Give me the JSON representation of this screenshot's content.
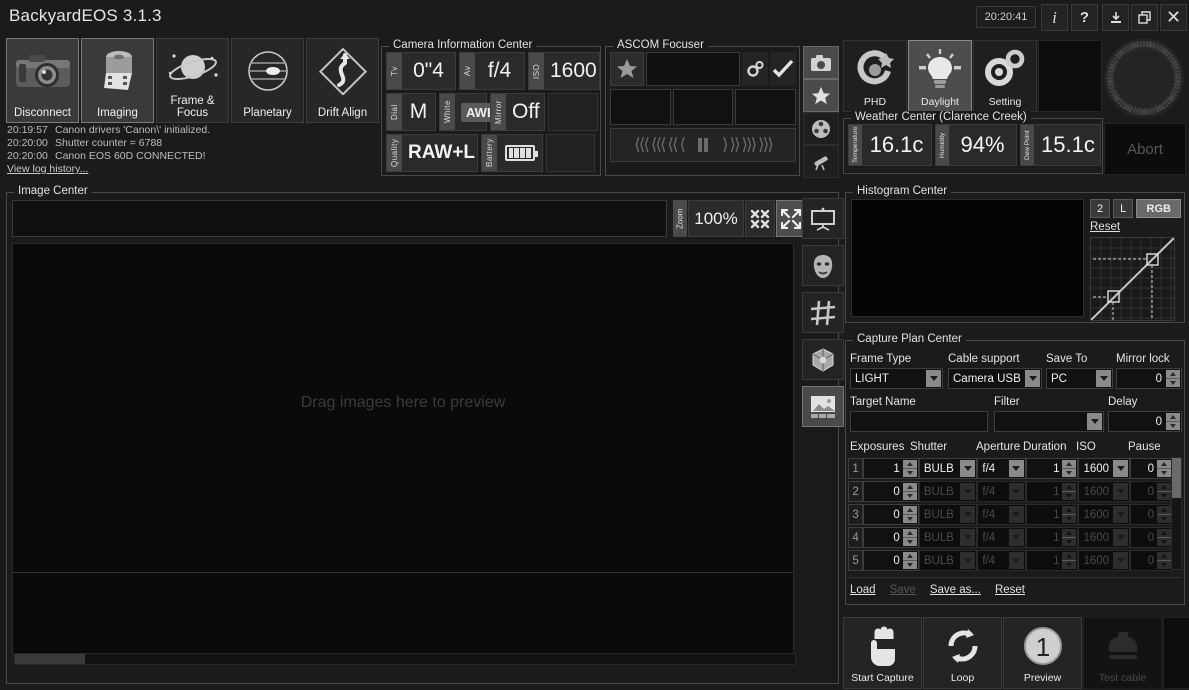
{
  "titlebar": {
    "app_title": "BackyardEOS 3.1.3",
    "clock": "20:20:41",
    "info_label": "i",
    "help_label": "?",
    "download_icon": "download-icon",
    "restore_icon": "restore-window-icon",
    "close_label": "✕"
  },
  "modebar": {
    "buttons": [
      {
        "label": "Disconnect",
        "icon": "dslr-camera-icon",
        "selected": true
      },
      {
        "label": "Imaging",
        "icon": "film-roll-icon",
        "selected": true
      },
      {
        "label": "Frame & Focus",
        "icon": "ringed-planet-icon",
        "selected": false
      },
      {
        "label": "Planetary",
        "icon": "jupiter-planet-icon",
        "selected": false
      },
      {
        "label": "Drift Align",
        "icon": "drift-align-diamond-icon",
        "selected": false
      }
    ]
  },
  "log": {
    "lines": [
      {
        "time": "20:19:57",
        "text": "Canon drivers 'Canon\\' initialized."
      },
      {
        "time": "20:20:00",
        "text": "Shutter counter = 6788"
      },
      {
        "time": "20:20:00",
        "text": "Canon EOS 60D CONNECTED!"
      }
    ],
    "history_link": "View log history..."
  },
  "camera_info": {
    "title": "Camera Information Center",
    "tv_tag": "Tv",
    "tv_value": "0\"4",
    "av_tag": "Av",
    "av_value": "f/4",
    "iso_tag": "ISO",
    "iso_value": "1600",
    "dial_tag": "Dial",
    "dial_value": "M",
    "white_tag": "White",
    "white_value": "AWB",
    "mirror_tag": "Mirror",
    "mirror_value": "Off",
    "quality_tag": "Quality",
    "quality_value": "RAW+L",
    "battery_tag": "Battery",
    "battery_level": 4
  },
  "ascom": {
    "title": "ASCOM Focuser",
    "star_icon": "star-icon",
    "position_value": "",
    "gear_icon": "gears-icon",
    "check_icon": "checkmark-icon",
    "in_arrows": "⟨⟨⟨ ⟨⟨⟨ ⟨⟨ ⟨",
    "pause_icon": "pause-icon",
    "out_arrows": "⟩ ⟩⟩ ⟩⟩⟩ ⟩⟩⟩"
  },
  "icon_strip": [
    {
      "icon": "camera-icon",
      "selected": true
    },
    {
      "icon": "star-icon",
      "selected": true
    },
    {
      "icon": "filter-wheel-icon",
      "selected": false
    },
    {
      "icon": "telescope-icon",
      "selected": false
    }
  ],
  "pds": {
    "buttons": [
      {
        "label": "PHD",
        "icon": "phd-guiding-icon",
        "selected": false
      },
      {
        "label": "Daylight",
        "icon": "lightbulb-icon",
        "selected": true
      },
      {
        "label": "Setting",
        "icon": "gears-icon",
        "selected": false
      }
    ]
  },
  "weather": {
    "title": "Weather Center (Clarence Creek)",
    "temperature_tag": "Temperature",
    "temperature_value": "16.1c",
    "humidity_tag": "Humidity",
    "humidity_value": "94%",
    "dewpoint_tag": "Dew Point",
    "dewpoint_value": "15.1c"
  },
  "abort": {
    "label": "Abort"
  },
  "image_center": {
    "title": "Image Center",
    "filename_value": "",
    "zoom_tag": "Zoom",
    "zoom_value": "100%",
    "zoom_out_icon": "zoom-shrink-icon",
    "zoom_fit_icon": "zoom-expand-icon",
    "projector_icon": "projector-screen-icon",
    "drag_hint": "Drag images here to preview",
    "sidebar": [
      {
        "icon": "mask-icon",
        "selected": false
      },
      {
        "icon": "grid-hash-icon",
        "selected": false
      },
      {
        "icon": "cube-3d-icon",
        "selected": false
      },
      {
        "icon": "image-thumbnails-icon",
        "selected": true
      }
    ]
  },
  "histogram": {
    "title": "Histogram Center",
    "btn_2": "2",
    "btn_l": "L",
    "btn_rgb": "RGB",
    "reset_link": "Reset"
  },
  "capture": {
    "title": "Capture Plan Center",
    "frame_type_label": "Frame Type",
    "frame_type_value": "LIGHT",
    "cable_support_label": "Cable support",
    "cable_support_value": "Camera USB",
    "save_to_label": "Save To",
    "save_to_value": "PC",
    "mirror_lock_label": "Mirror lock",
    "mirror_lock_value": "0",
    "target_name_label": "Target Name",
    "target_name_value": "",
    "filter_label": "Filter",
    "filter_value": "",
    "delay_label": "Delay",
    "delay_value": "0",
    "columns": [
      "Exposures",
      "Shutter",
      "Aperture",
      "Duration",
      "ISO",
      "Pause"
    ],
    "rows": [
      {
        "idx": "1",
        "exposures": "1",
        "shutter": "BULB",
        "aperture": "f/4",
        "duration": "1",
        "iso": "1600",
        "pause": "0",
        "enabled": true
      },
      {
        "idx": "2",
        "exposures": "0",
        "shutter": "BULB",
        "aperture": "f/4",
        "duration": "1",
        "iso": "1600",
        "pause": "0",
        "enabled": false
      },
      {
        "idx": "3",
        "exposures": "0",
        "shutter": "BULB",
        "aperture": "f/4",
        "duration": "1",
        "iso": "1600",
        "pause": "0",
        "enabled": false
      },
      {
        "idx": "4",
        "exposures": "0",
        "shutter": "BULB",
        "aperture": "f/4",
        "duration": "1",
        "iso": "1600",
        "pause": "0",
        "enabled": false
      },
      {
        "idx": "5",
        "exposures": "0",
        "shutter": "BULB",
        "aperture": "f/4",
        "duration": "1",
        "iso": "1600",
        "pause": "0",
        "enabled": false
      }
    ],
    "links": [
      {
        "label": "Load",
        "enabled": true
      },
      {
        "label": "Save",
        "enabled": false
      },
      {
        "label": "Save as...",
        "enabled": true
      },
      {
        "label": "Reset",
        "enabled": true
      }
    ]
  },
  "actions": {
    "buttons": [
      {
        "label": "Start Capture",
        "icon": "hand-press-icon",
        "enabled": true
      },
      {
        "label": "Loop",
        "icon": "loop-arrows-icon",
        "enabled": true
      },
      {
        "label": "Preview",
        "icon": "preview-one-icon",
        "enabled": true
      },
      {
        "label": "Test cable",
        "icon": "cable-tester-icon",
        "enabled": false
      }
    ]
  },
  "colors": {
    "background": "#1b1b1b",
    "panel": "#242424",
    "field": "#111111",
    "text": "#e6e6e6",
    "selected": "#4d4d4d"
  }
}
